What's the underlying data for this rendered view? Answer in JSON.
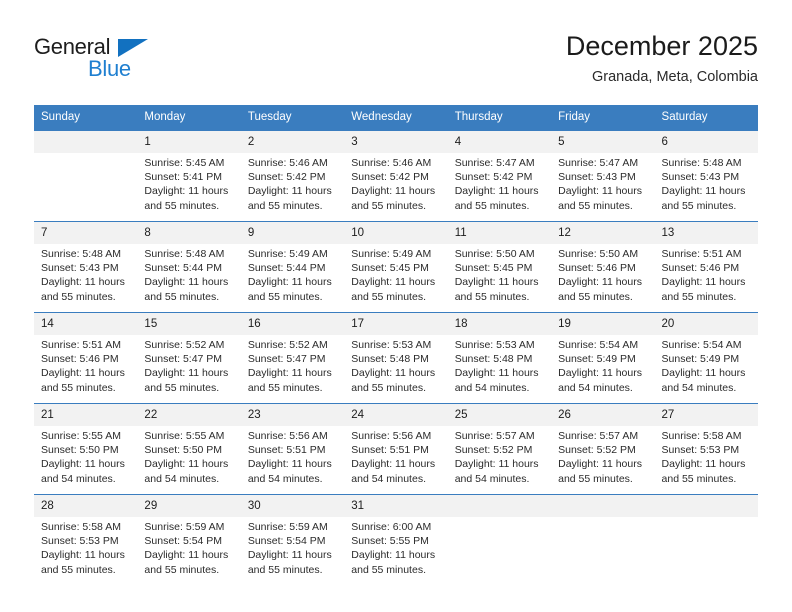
{
  "brand": {
    "name_top": "General",
    "name_bottom": "Blue",
    "triangle_color": "#1271c0",
    "blue_color": "#1f7fd0"
  },
  "header": {
    "title": "December 2025",
    "subtitle": "Granada, Meta, Colombia"
  },
  "theme": {
    "header_blue": "#3a7dbf",
    "daynum_band": "#f2f2f2",
    "text": "#2b2b2b"
  },
  "calendar": {
    "weekdays": [
      "Sunday",
      "Monday",
      "Tuesday",
      "Wednesday",
      "Thursday",
      "Friday",
      "Saturday"
    ],
    "weeks": [
      [
        {
          "day": "",
          "sunrise": "",
          "sunset": "",
          "daylight1": "",
          "daylight2": ""
        },
        {
          "day": "1",
          "sunrise": "Sunrise: 5:45 AM",
          "sunset": "Sunset: 5:41 PM",
          "daylight1": "Daylight: 11 hours",
          "daylight2": "and 55 minutes."
        },
        {
          "day": "2",
          "sunrise": "Sunrise: 5:46 AM",
          "sunset": "Sunset: 5:42 PM",
          "daylight1": "Daylight: 11 hours",
          "daylight2": "and 55 minutes."
        },
        {
          "day": "3",
          "sunrise": "Sunrise: 5:46 AM",
          "sunset": "Sunset: 5:42 PM",
          "daylight1": "Daylight: 11 hours",
          "daylight2": "and 55 minutes."
        },
        {
          "day": "4",
          "sunrise": "Sunrise: 5:47 AM",
          "sunset": "Sunset: 5:42 PM",
          "daylight1": "Daylight: 11 hours",
          "daylight2": "and 55 minutes."
        },
        {
          "day": "5",
          "sunrise": "Sunrise: 5:47 AM",
          "sunset": "Sunset: 5:43 PM",
          "daylight1": "Daylight: 11 hours",
          "daylight2": "and 55 minutes."
        },
        {
          "day": "6",
          "sunrise": "Sunrise: 5:48 AM",
          "sunset": "Sunset: 5:43 PM",
          "daylight1": "Daylight: 11 hours",
          "daylight2": "and 55 minutes."
        }
      ],
      [
        {
          "day": "7",
          "sunrise": "Sunrise: 5:48 AM",
          "sunset": "Sunset: 5:43 PM",
          "daylight1": "Daylight: 11 hours",
          "daylight2": "and 55 minutes."
        },
        {
          "day": "8",
          "sunrise": "Sunrise: 5:48 AM",
          "sunset": "Sunset: 5:44 PM",
          "daylight1": "Daylight: 11 hours",
          "daylight2": "and 55 minutes."
        },
        {
          "day": "9",
          "sunrise": "Sunrise: 5:49 AM",
          "sunset": "Sunset: 5:44 PM",
          "daylight1": "Daylight: 11 hours",
          "daylight2": "and 55 minutes."
        },
        {
          "day": "10",
          "sunrise": "Sunrise: 5:49 AM",
          "sunset": "Sunset: 5:45 PM",
          "daylight1": "Daylight: 11 hours",
          "daylight2": "and 55 minutes."
        },
        {
          "day": "11",
          "sunrise": "Sunrise: 5:50 AM",
          "sunset": "Sunset: 5:45 PM",
          "daylight1": "Daylight: 11 hours",
          "daylight2": "and 55 minutes."
        },
        {
          "day": "12",
          "sunrise": "Sunrise: 5:50 AM",
          "sunset": "Sunset: 5:46 PM",
          "daylight1": "Daylight: 11 hours",
          "daylight2": "and 55 minutes."
        },
        {
          "day": "13",
          "sunrise": "Sunrise: 5:51 AM",
          "sunset": "Sunset: 5:46 PM",
          "daylight1": "Daylight: 11 hours",
          "daylight2": "and 55 minutes."
        }
      ],
      [
        {
          "day": "14",
          "sunrise": "Sunrise: 5:51 AM",
          "sunset": "Sunset: 5:46 PM",
          "daylight1": "Daylight: 11 hours",
          "daylight2": "and 55 minutes."
        },
        {
          "day": "15",
          "sunrise": "Sunrise: 5:52 AM",
          "sunset": "Sunset: 5:47 PM",
          "daylight1": "Daylight: 11 hours",
          "daylight2": "and 55 minutes."
        },
        {
          "day": "16",
          "sunrise": "Sunrise: 5:52 AM",
          "sunset": "Sunset: 5:47 PM",
          "daylight1": "Daylight: 11 hours",
          "daylight2": "and 55 minutes."
        },
        {
          "day": "17",
          "sunrise": "Sunrise: 5:53 AM",
          "sunset": "Sunset: 5:48 PM",
          "daylight1": "Daylight: 11 hours",
          "daylight2": "and 55 minutes."
        },
        {
          "day": "18",
          "sunrise": "Sunrise: 5:53 AM",
          "sunset": "Sunset: 5:48 PM",
          "daylight1": "Daylight: 11 hours",
          "daylight2": "and 54 minutes."
        },
        {
          "day": "19",
          "sunrise": "Sunrise: 5:54 AM",
          "sunset": "Sunset: 5:49 PM",
          "daylight1": "Daylight: 11 hours",
          "daylight2": "and 54 minutes."
        },
        {
          "day": "20",
          "sunrise": "Sunrise: 5:54 AM",
          "sunset": "Sunset: 5:49 PM",
          "daylight1": "Daylight: 11 hours",
          "daylight2": "and 54 minutes."
        }
      ],
      [
        {
          "day": "21",
          "sunrise": "Sunrise: 5:55 AM",
          "sunset": "Sunset: 5:50 PM",
          "daylight1": "Daylight: 11 hours",
          "daylight2": "and 54 minutes."
        },
        {
          "day": "22",
          "sunrise": "Sunrise: 5:55 AM",
          "sunset": "Sunset: 5:50 PM",
          "daylight1": "Daylight: 11 hours",
          "daylight2": "and 54 minutes."
        },
        {
          "day": "23",
          "sunrise": "Sunrise: 5:56 AM",
          "sunset": "Sunset: 5:51 PM",
          "daylight1": "Daylight: 11 hours",
          "daylight2": "and 54 minutes."
        },
        {
          "day": "24",
          "sunrise": "Sunrise: 5:56 AM",
          "sunset": "Sunset: 5:51 PM",
          "daylight1": "Daylight: 11 hours",
          "daylight2": "and 54 minutes."
        },
        {
          "day": "25",
          "sunrise": "Sunrise: 5:57 AM",
          "sunset": "Sunset: 5:52 PM",
          "daylight1": "Daylight: 11 hours",
          "daylight2": "and 54 minutes."
        },
        {
          "day": "26",
          "sunrise": "Sunrise: 5:57 AM",
          "sunset": "Sunset: 5:52 PM",
          "daylight1": "Daylight: 11 hours",
          "daylight2": "and 55 minutes."
        },
        {
          "day": "27",
          "sunrise": "Sunrise: 5:58 AM",
          "sunset": "Sunset: 5:53 PM",
          "daylight1": "Daylight: 11 hours",
          "daylight2": "and 55 minutes."
        }
      ],
      [
        {
          "day": "28",
          "sunrise": "Sunrise: 5:58 AM",
          "sunset": "Sunset: 5:53 PM",
          "daylight1": "Daylight: 11 hours",
          "daylight2": "and 55 minutes."
        },
        {
          "day": "29",
          "sunrise": "Sunrise: 5:59 AM",
          "sunset": "Sunset: 5:54 PM",
          "daylight1": "Daylight: 11 hours",
          "daylight2": "and 55 minutes."
        },
        {
          "day": "30",
          "sunrise": "Sunrise: 5:59 AM",
          "sunset": "Sunset: 5:54 PM",
          "daylight1": "Daylight: 11 hours",
          "daylight2": "and 55 minutes."
        },
        {
          "day": "31",
          "sunrise": "Sunrise: 6:00 AM",
          "sunset": "Sunset: 5:55 PM",
          "daylight1": "Daylight: 11 hours",
          "daylight2": "and 55 minutes."
        },
        {
          "day": "",
          "sunrise": "",
          "sunset": "",
          "daylight1": "",
          "daylight2": ""
        },
        {
          "day": "",
          "sunrise": "",
          "sunset": "",
          "daylight1": "",
          "daylight2": ""
        },
        {
          "day": "",
          "sunrise": "",
          "sunset": "",
          "daylight1": "",
          "daylight2": ""
        }
      ]
    ]
  }
}
